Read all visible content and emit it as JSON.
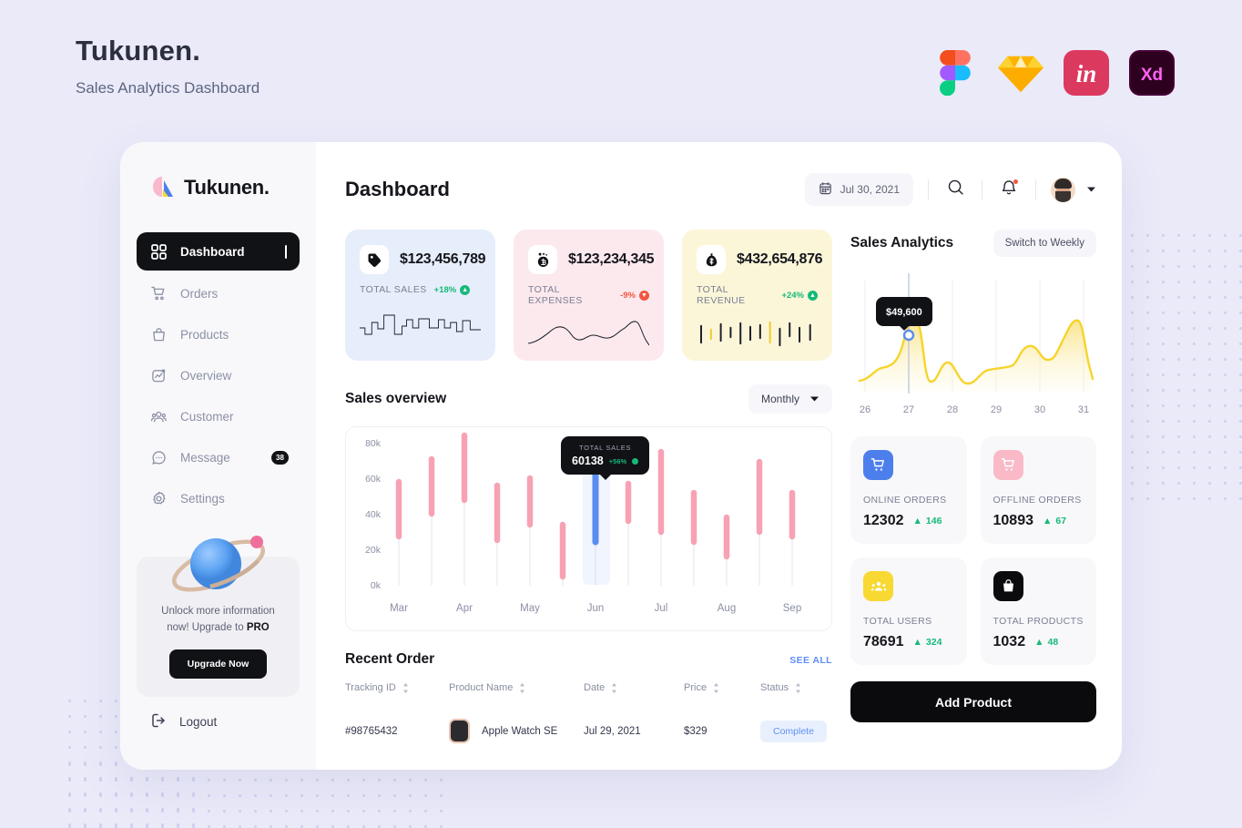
{
  "page": {
    "brand_title": "Tukunen.",
    "brand_subtitle": "Sales Analytics Dashboard",
    "tool_icons": [
      "figma-icon",
      "sketch-icon",
      "invision-icon",
      "adobe-xd-icon"
    ]
  },
  "sidebar": {
    "logo_text": "Tukunen.",
    "items": [
      {
        "label": "Dashboard",
        "icon": "grid-icon",
        "active": true,
        "badge": ""
      },
      {
        "label": "Orders",
        "icon": "cart-icon",
        "active": false,
        "badge": ""
      },
      {
        "label": "Products",
        "icon": "bag-icon",
        "active": false,
        "badge": ""
      },
      {
        "label": "Overview",
        "icon": "chart-square-icon",
        "active": false,
        "badge": ""
      },
      {
        "label": "Customer",
        "icon": "users-icon",
        "active": false,
        "badge": ""
      },
      {
        "label": "Message",
        "icon": "chat-icon",
        "active": false,
        "badge": "38"
      },
      {
        "label": "Settings",
        "icon": "gear-icon",
        "active": false,
        "badge": ""
      }
    ],
    "promo": {
      "line1": "Unlock more information",
      "line2_prefix": "now! Upgrade to ",
      "line2_strong": "PRO",
      "button": "Upgrade Now"
    },
    "logout_label": "Logout"
  },
  "header": {
    "title": "Dashboard",
    "date": "Jul 30, 2021",
    "icons": [
      "calendar-icon",
      "search-icon",
      "bell-icon",
      "avatar",
      "chevron-down-icon"
    ]
  },
  "stats": [
    {
      "icon": "tag-icon",
      "value": "$123,456,789",
      "label": "TOTAL SALES",
      "delta": "+18%",
      "direction": "up",
      "theme": "blue",
      "accent": "#5b8def"
    },
    {
      "icon": "coin-icon",
      "value": "$123,234,345",
      "label": "TOTAL EXPENSES",
      "delta": "-9%",
      "direction": "down",
      "theme": "pink",
      "accent": "#f2563f"
    },
    {
      "icon": "money-bag-icon",
      "value": "$432,654,876",
      "label": "TOTAL REVENUE",
      "delta": "+24%",
      "direction": "up",
      "theme": "yellow",
      "accent": "#f7d13d"
    }
  ],
  "sales_overview": {
    "title": "Sales overview",
    "range_label": "Monthly",
    "tooltip": {
      "label": "TOTAL SALES",
      "value": "60138",
      "delta": "+56%"
    }
  },
  "sales_analytics": {
    "title": "Sales Analytics",
    "switch_label": "Switch to Weekly",
    "tooltip_value": "$49,600"
  },
  "recent_order": {
    "title": "Recent Order",
    "see_all": "SEE ALL",
    "columns": [
      "Tracking ID",
      "Product Name",
      "Date",
      "Price",
      "Status"
    ],
    "rows": [
      {
        "tracking_id": "#98765432",
        "product": "Apple Watch SE",
        "date": "Jul 29, 2021",
        "price": "$329",
        "status": "Complete"
      }
    ]
  },
  "metrics": [
    {
      "label": "ONLINE ORDERS",
      "value": "12302",
      "delta": "146",
      "icon": "cart-icon",
      "bg": "#4d7fec",
      "fg": "#ffffff"
    },
    {
      "label": "OFFLINE ORDERS",
      "value": "10893",
      "delta": "67",
      "icon": "cart-icon",
      "bg": "#f9b9c6",
      "fg": "#ffffff"
    },
    {
      "label": "TOTAL USERS",
      "value": "78691",
      "delta": "324",
      "icon": "users-icon",
      "bg": "#f8d832",
      "fg": "#ffffff"
    },
    {
      "label": "TOTAL PRODUCTS",
      "value": "1032",
      "delta": "48",
      "icon": "bag-icon",
      "bg": "#0b0b0e",
      "fg": "#ffffff"
    }
  ],
  "add_product_button": "Add Product",
  "chart_data": [
    {
      "type": "bar",
      "name": "Sales overview",
      "title": "Sales overview",
      "xlabel": "",
      "ylabel": "",
      "ylim": [
        0,
        90000
      ],
      "yticks": [
        0,
        20000,
        40000,
        60000,
        80000
      ],
      "ytick_labels": [
        "0k",
        "20k",
        "40k",
        "60k",
        "80k"
      ],
      "categories": [
        "Mar",
        "Apr",
        "May",
        "Jun",
        "Jul",
        "Aug",
        "Sep"
      ],
      "bar_style": "floating-range",
      "bars": [
        {
          "month": "Mar",
          "low": 27000,
          "high": 60000,
          "highlight": false
        },
        {
          "month": "Mar",
          "low": 40000,
          "high": 71000,
          "highlight": false
        },
        {
          "month": "Apr",
          "low": 48000,
          "high": 84000,
          "highlight": false
        },
        {
          "month": "Apr",
          "low": 25000,
          "high": 56000,
          "highlight": false
        },
        {
          "month": "May",
          "low": 34000,
          "high": 60000,
          "highlight": false
        },
        {
          "month": "May",
          "low": 5000,
          "high": 34000,
          "highlight": false
        },
        {
          "month": "Jun",
          "low": 24000,
          "high": 62000,
          "highlight": true
        },
        {
          "month": "Jun",
          "low": 36000,
          "high": 57000,
          "highlight": false
        },
        {
          "month": "Jul",
          "low": 30000,
          "high": 75000,
          "highlight": false
        },
        {
          "month": "Jul",
          "low": 24000,
          "high": 52000,
          "highlight": false
        },
        {
          "month": "Aug",
          "low": 16000,
          "high": 38000,
          "highlight": false
        },
        {
          "month": "Aug",
          "low": 30000,
          "high": 69000,
          "highlight": false
        },
        {
          "month": "Sep",
          "low": 27000,
          "high": 52000,
          "highlight": false
        }
      ],
      "colors": {
        "bar": "#f7a2b4",
        "highlight": "#5b8def",
        "track": "#f2f2f6"
      }
    },
    {
      "type": "area",
      "name": "Sales Analytics",
      "title": "Sales Analytics",
      "xlabel": "",
      "ylabel": "",
      "x": [
        26,
        27,
        28,
        29,
        30,
        31
      ],
      "xtick_labels": [
        "26",
        "27",
        "28",
        "29",
        "30",
        "31"
      ],
      "marker": {
        "x": 27,
        "value_label": "$49,600"
      },
      "grid": "vertical",
      "color": "#f6d42c",
      "values_normalized": [
        0.12,
        0.62,
        0.3,
        0.22,
        0.45,
        0.8
      ]
    }
  ]
}
